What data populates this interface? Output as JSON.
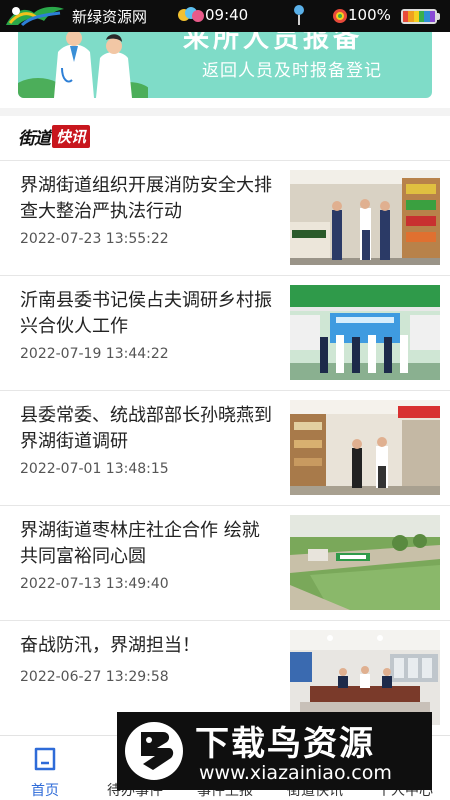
{
  "status_bar": {
    "site_name": "新绿资源网",
    "time": "09:40",
    "battery": "100%",
    "icons": [
      "horse-logo-icon",
      "balloons-icon",
      "map-pin-icon",
      "gem-icon",
      "battery-icon"
    ]
  },
  "banner": {
    "title": "来所人员报备",
    "subtitle": "返回人员及时报备登记",
    "bg_color": "#7fdcc8"
  },
  "section": {
    "name_a": "街道",
    "name_b": "快讯",
    "accent": "#c8161d"
  },
  "news": [
    {
      "title": "界湖街道组织开展消防安全大排查大整治严执法行动",
      "date": "2022-07-23 13:55:22"
    },
    {
      "title": "沂南县委书记侯占夫调研乡村振兴合伙人工作",
      "date": "2022-07-19 13:44:22"
    },
    {
      "title": "县委常委、统战部部长孙晓燕到界湖街道调研",
      "date": "2022-07-01 13:48:15"
    },
    {
      "title": "界湖街道枣林庄社企合作 绘就共同富裕同心圆",
      "date": "2022-07-13 13:49:40"
    },
    {
      "title": "奋战防汛，界湖担当！",
      "date": "2022-06-27 13:29:58"
    }
  ],
  "bottom_nav": {
    "items": [
      {
        "label": "首页",
        "icon": "home-icon",
        "active": true
      },
      {
        "label": "待办事件",
        "icon": "todo-icon",
        "active": false
      },
      {
        "label": "事件上报",
        "icon": "report-icon",
        "active": false
      },
      {
        "label": "街道快讯",
        "icon": "news-icon",
        "active": false
      },
      {
        "label": "个人中心",
        "icon": "user-icon",
        "active": false
      }
    ],
    "active_color": "#2e6bd8"
  },
  "watermark": {
    "brand": "下载鸟资源",
    "url": "www.xiazainiao.com"
  }
}
